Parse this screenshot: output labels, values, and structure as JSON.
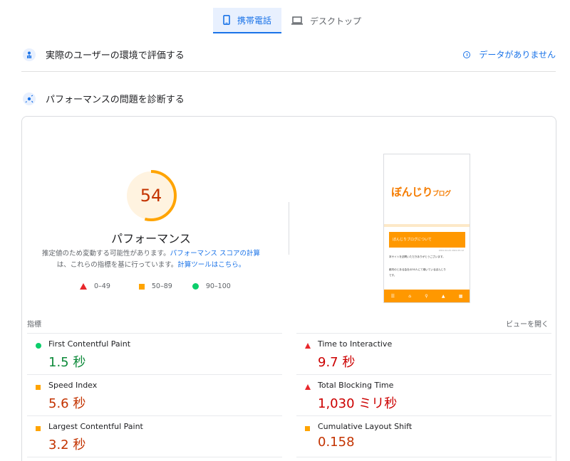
{
  "tabs": [
    {
      "label": "携帯電話",
      "active": true
    },
    {
      "label": "デスクトップ",
      "active": false
    }
  ],
  "field_data": {
    "title": "実際のユーザーの環境で評価する",
    "no_data": "データがありません"
  },
  "diagnose": {
    "title": "パフォーマンスの問題を診断する"
  },
  "score": {
    "value": 54,
    "fraction": 0.54,
    "label": "パフォーマンス",
    "color": "#ffa400"
  },
  "note": {
    "part1": "推定値のため変動する可能性があります。",
    "link1": "パフォーマンス スコアの計算",
    "part2": "は、これらの指標を基に行っています。",
    "link2": "計算ツールはこちら。"
  },
  "legend": [
    {
      "range": "0–49",
      "shape": "triangle",
      "color": "#e8272b"
    },
    {
      "range": "50–89",
      "shape": "square",
      "color": "#ffa400"
    },
    {
      "range": "90–100",
      "shape": "circle",
      "color": "#0cce6b"
    }
  ],
  "screenshot": {
    "logo_main": "ぼんじり",
    "logo_sub": "ブログ",
    "box_title": "ぼんじりブログについて",
    "meta": "2021.04.20  2021.05.12",
    "line1": "本サイトを訪問いただきありがとうございます。",
    "line2": "都内のとある会社の50人にて働いているぼんじり",
    "line3": "です。"
  },
  "metrics_header": {
    "label": "指標",
    "view_toggle": "ビューを開く"
  },
  "metrics": [
    {
      "name": "First Contentful Paint",
      "value": "1.5 秒",
      "status": "good"
    },
    {
      "name": "Time to Interactive",
      "value": "9.7 秒",
      "status": "poor"
    },
    {
      "name": "Speed Index",
      "value": "5.6 秒",
      "status": "average"
    },
    {
      "name": "Total Blocking Time",
      "value": "1,030 ミリ秒",
      "status": "poor"
    },
    {
      "name": "Largest Contentful Paint",
      "value": "3.2 秒",
      "status": "average"
    },
    {
      "name": "Cumulative Layout Shift",
      "value": "0.158",
      "status": "average"
    }
  ]
}
